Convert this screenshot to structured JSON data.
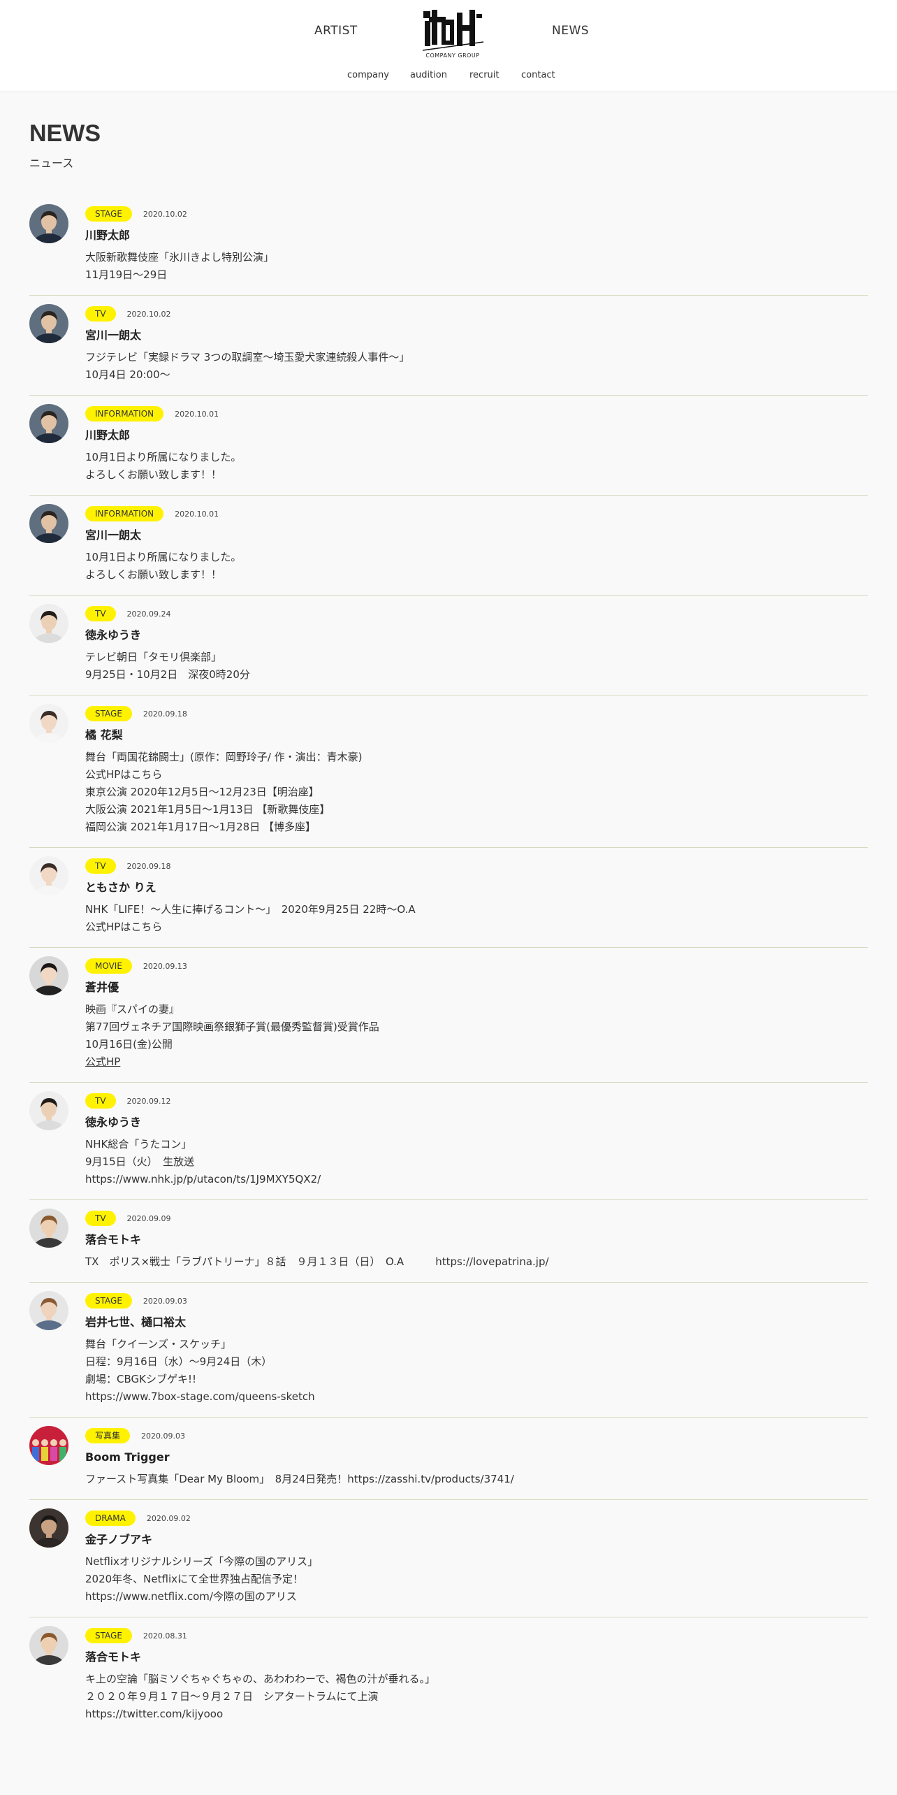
{
  "header": {
    "nav_artist": "ARTIST",
    "nav_news": "NEWS",
    "logo_text": "COMPANY GROUP",
    "sub_nav": [
      "company",
      "audition",
      "recruit",
      "contact"
    ]
  },
  "page": {
    "title": "NEWS",
    "subtitle": "ニュース"
  },
  "colors": {
    "tag_bg": "#fff200",
    "divider": "#d8d8c0"
  },
  "news": [
    {
      "tag": "STAGE",
      "date": "2020.10.02",
      "artist": "川野太郎",
      "lines": [
        "大阪新歌舞伎座「氷川きよし特別公演」",
        "11月19日〜29日"
      ],
      "avatar": "man-suit"
    },
    {
      "tag": "TV",
      "date": "2020.10.02",
      "artist": "宮川一朗太",
      "lines": [
        "フジテレビ「実録ドラマ 3つの取調室〜埼玉愛犬家連続殺人事件〜」",
        "10月4日 20:00〜"
      ],
      "avatar": "man-suit"
    },
    {
      "tag": "INFORMATION",
      "date": "2020.10.01",
      "artist": "川野太郎",
      "lines": [
        "10月1日より所属になりました。",
        "よろしくお願い致します！！"
      ],
      "avatar": "man-suit"
    },
    {
      "tag": "INFORMATION",
      "date": "2020.10.01",
      "artist": "宮川一朗太",
      "lines": [
        "10月1日より所属になりました。",
        "よろしくお願い致します！！"
      ],
      "avatar": "man-suit"
    },
    {
      "tag": "TV",
      "date": "2020.09.24",
      "artist": "徳永ゆうき",
      "lines": [
        "テレビ朝日「タモリ倶楽部」",
        "9月25日・10月2日　深夜0時20分"
      ],
      "avatar": "man-light"
    },
    {
      "tag": "STAGE",
      "date": "2020.09.18",
      "artist": "橘 花梨",
      "lines": [
        "舞台「両国花錦闘士」(原作：岡野玲子/ 作・演出：青木豪)",
        "公式HPはこちら",
        "東京公演 2020年12月5日～12月23日【明治座】",
        "大阪公演 2021年1月5日～1月13日 【新歌舞伎座】",
        "福岡公演 2021年1月17日～1月28日 【博多座】"
      ],
      "avatar": "woman-light"
    },
    {
      "tag": "TV",
      "date": "2020.09.18",
      "artist": "ともさか りえ",
      "lines": [
        "NHK「LIFE！～人生に捧げるコント～」　2020年9月25日 22時～O.A",
        "公式HPはこちら"
      ],
      "avatar": "woman-light"
    },
    {
      "tag": "MOVIE",
      "date": "2020.09.13",
      "artist": "蒼井優",
      "lines": [
        "映画『スパイの妻』",
        "第77回ヴェネチア国際映画祭銀獅子賞(最優秀監督賞)受賞作品",
        "10月16日(金)公開",
        "公式HP"
      ],
      "avatar": "woman-dark"
    },
    {
      "tag": "TV",
      "date": "2020.09.12",
      "artist": "徳永ゆうき",
      "lines": [
        "NHK総合「うたコン」",
        "9月15日（火）　生放送",
        "https://www.nhk.jp/p/utacon/ts/1J9MXY5QX2/"
      ],
      "avatar": "man-light"
    },
    {
      "tag": "TV",
      "date": "2020.09.09",
      "artist": "落合モトキ",
      "lines": [
        "TX　ポリス×戦士「ラブパトリーナ」８話　９月１３日（日）　O.A　　　https://lovepatrina.jp/"
      ],
      "avatar": "man-brown"
    },
    {
      "tag": "STAGE",
      "date": "2020.09.03",
      "artist": "岩井七世、樋口裕太",
      "lines": [
        "舞台「クイーンズ・スケッチ」",
        "日程：9月16日（水）～9月24日（木）",
        "劇場：CBGKシブゲキ!!",
        "https://www.7box-stage.com/queens-sketch"
      ],
      "avatar": "woman-brown"
    },
    {
      "tag": "写真集",
      "date": "2020.09.03",
      "artist": "Boom Trigger",
      "lines": [
        "ファースト写真集「Dear My Bloom」　8月24日発売！https://zasshi.tv/products/3741/"
      ],
      "avatar": "group"
    },
    {
      "tag": "DRAMA",
      "date": "2020.09.02",
      "artist": "金子ノブアキ",
      "lines": [
        "Netflixオリジナルシリーズ「今際の国のアリス」",
        "2020年冬、Netflixにて全世界独占配信予定！",
        "https://www.netflix.com/今際の国のアリス"
      ],
      "avatar": "man-dark"
    },
    {
      "tag": "STAGE",
      "date": "2020.08.31",
      "artist": "落合モトキ",
      "lines": [
        "キ上の空論「脳ミソぐちゃぐちゃの、あわわわーで、褐色の汁が垂れる。」",
        "２０２０年９月１７日～９月２７日　シアタートラムにて上演",
        "https://twitter.com/kijyooo"
      ],
      "avatar": "man-brown"
    }
  ]
}
